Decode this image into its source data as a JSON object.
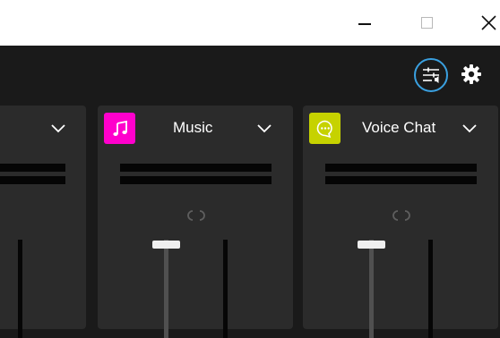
{
  "window": {
    "controls": {
      "minimize_icon": "minimize-icon",
      "maximize_icon": "maximize-icon",
      "close_icon": "close-icon"
    }
  },
  "toolbar": {
    "mixer_icon": "sliders-icon",
    "settings_icon": "gear-icon",
    "accent_color": "#3aa0e0"
  },
  "channels": [
    {
      "name": "",
      "icon_color": "",
      "icon": ""
    },
    {
      "name": "Music",
      "icon_color": "#ff00cc",
      "icon": "music-note-icon"
    },
    {
      "name": "Voice Chat",
      "icon_color": "#c6d200",
      "icon": "chat-bubble-icon"
    }
  ]
}
